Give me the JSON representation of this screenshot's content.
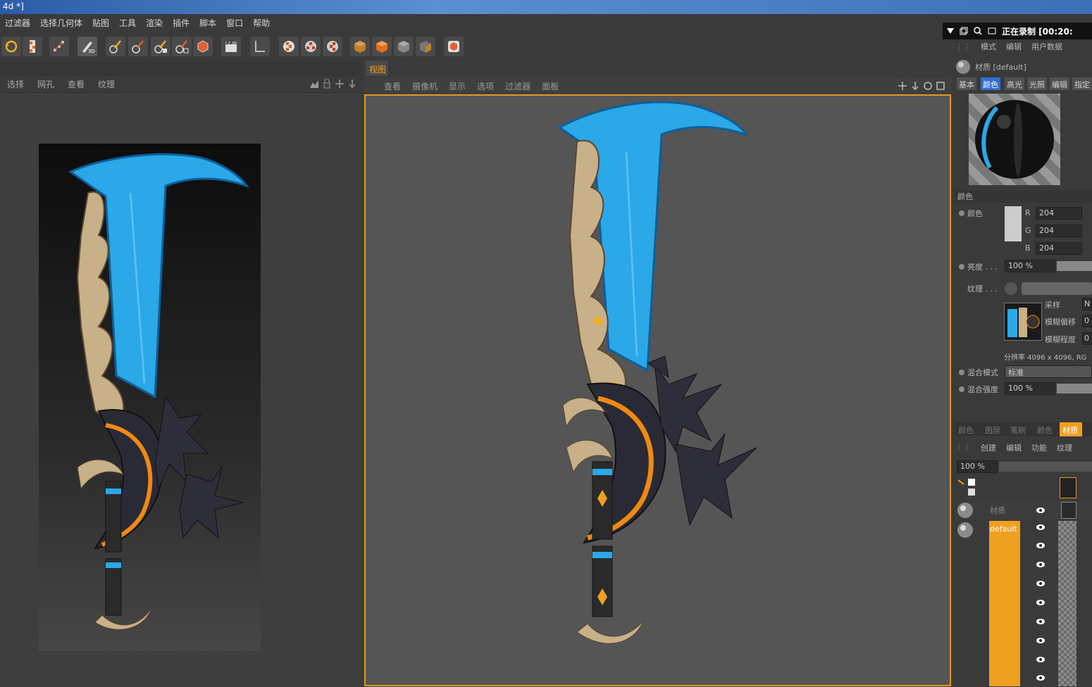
{
  "window": {
    "title": "4d *]"
  },
  "menubar": [
    "过滤器",
    "选择几何体",
    "贴图",
    "工具",
    "渲染",
    "插件",
    "脚本",
    "窗口",
    "帮助"
  ],
  "left_panel": {
    "menu": [
      "选择",
      "网孔",
      "查看",
      "纹理"
    ]
  },
  "viewport": {
    "tab": "视图",
    "menu": [
      "查看",
      "摄像机",
      "显示",
      "选项",
      "过滤器",
      "面板"
    ]
  },
  "recording": {
    "label": "正在录制 [00:20:"
  },
  "attributes": {
    "menu": [
      "模式",
      "编辑",
      "用户数据"
    ],
    "material_name": "材质 [default]",
    "tabs": [
      "基本",
      "颜色",
      "高光",
      "光照",
      "编辑",
      "指定"
    ],
    "active_tab": "颜色",
    "section_title": "颜色",
    "color_label": "颜色",
    "r_label": "R",
    "g_label": "G",
    "b_label": "B",
    "r": "204",
    "g": "204",
    "b": "204",
    "brightness_label": "亮度 . . .",
    "brightness": "100 %",
    "texture_label": "纹理 . . .",
    "sampling_label": "采样",
    "blur_offset_label": "模糊偏移",
    "blur_scale_label": "模糊程度",
    "sampling_value": "N",
    "blur_offset": "0",
    "blur_scale": "0",
    "resolution": "分辨率 4096 x 4096, RG",
    "blend_mode_label": "混合模式",
    "blend_mode": "标准",
    "blend_strength_label": "混合强度",
    "blend_strength": "100 %"
  },
  "layers": {
    "tabs": [
      "颜色",
      "图层",
      "笔刷",
      "颜色",
      "材质"
    ],
    "active_tab": "材质",
    "menu": [
      "创建",
      "编辑",
      "功能",
      "纹理"
    ],
    "zoom": "100 %",
    "rows": [
      {
        "name": "材质",
        "selected": false
      },
      {
        "name": "default",
        "selected": true
      }
    ]
  },
  "colors": {
    "accent": "#f0a020",
    "bg": "#3b3b3b",
    "viewport_bg": "#555555"
  }
}
